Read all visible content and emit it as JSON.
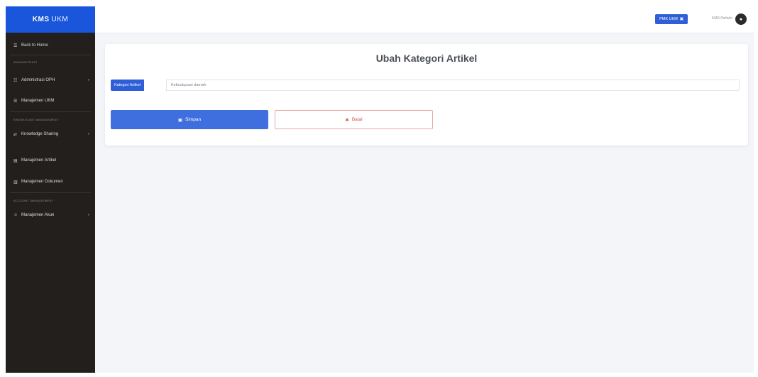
{
  "sidebar": {
    "brand": "KMS",
    "brand_sub": "UKM",
    "items": [
      {
        "label": "Back to Home",
        "icon": "arrow-left-icon",
        "chevron": false
      },
      {
        "label": "Administrasi OPH",
        "icon": "people-icon",
        "chevron": true
      },
      {
        "label": "Manajemen UKM",
        "icon": "list-icon",
        "chevron": false
      },
      {
        "label": "Knowledge Sharing",
        "icon": "share-icon",
        "chevron": true
      },
      {
        "label": "Manajemen Artikel",
        "icon": "document-icon",
        "chevron": false
      },
      {
        "label": "Manajemen Dokumen",
        "icon": "file-icon",
        "chevron": false
      },
      {
        "label": "Manajemen Akun",
        "icon": "user-icon",
        "chevron": true
      }
    ],
    "headings": [
      "Administrasi",
      "Knowledge Management",
      "Account Management"
    ]
  },
  "topbar": {
    "button_label": "PMK UKM",
    "user_name": "KMS Pelindo"
  },
  "form": {
    "title": "Ubah Kategori Artikel",
    "field_label": "Kategori Artikel",
    "field_value": "Kebudayaan daerah",
    "save_label": "Simpan",
    "back_label": "Batal"
  },
  "colors": {
    "brand": "#1a56db",
    "sidebar_bg": "#221f1c",
    "primary": "#3f6fde",
    "danger": "#d9534f"
  }
}
